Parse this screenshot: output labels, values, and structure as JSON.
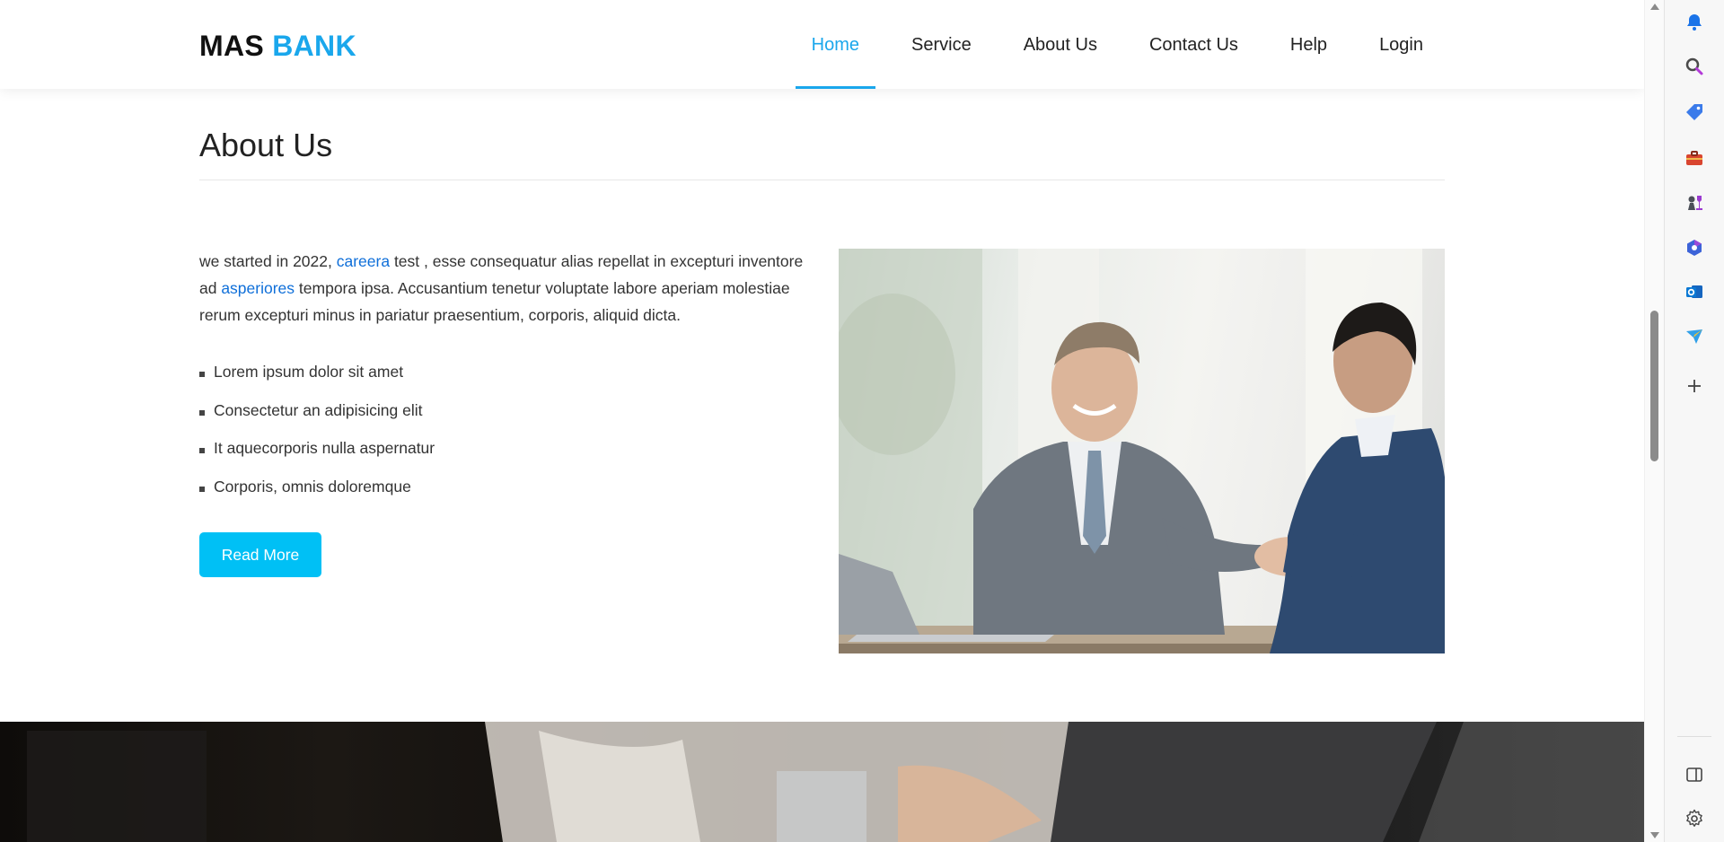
{
  "brand": {
    "part1": "MAS",
    "part2": "BANK"
  },
  "nav": {
    "items": [
      {
        "label": "Home",
        "active": true
      },
      {
        "label": "Service",
        "active": false
      },
      {
        "label": "About Us",
        "active": false
      },
      {
        "label": "Contact Us",
        "active": false
      },
      {
        "label": "Help",
        "active": false
      },
      {
        "label": "Login",
        "active": false
      }
    ]
  },
  "about": {
    "title": "About Us",
    "intro": {
      "part1": "we started in 2022, ",
      "link1": "careera",
      "part2": " test , esse consequatur alias repellat in excepturi inventore ad ",
      "link2": "asperiores",
      "part3": " tempora ipsa. Accusantium tenetur voluptate labore aperiam molestiae rerum excepturi minus in pariatur praesentium, corporis, aliquid dicta."
    },
    "features": [
      "Lorem ipsum dolor sit amet",
      "Consectetur an adipisicing elit",
      "It aquecorporis nulla aspernatur",
      "Corporis, omnis doloremque"
    ],
    "button_label": "Read More"
  },
  "colors": {
    "accent": "#1aa7ec",
    "button": "#00c0f5",
    "link": "#0f6fd9"
  },
  "side_panel": {
    "icons": [
      "bell-icon",
      "search-icon",
      "tag-icon",
      "toolbox-icon",
      "chess-icon",
      "copilot-icon",
      "outlook-icon",
      "send-icon",
      "plus-icon",
      "sidebar-toggle-icon",
      "settings-icon"
    ]
  }
}
